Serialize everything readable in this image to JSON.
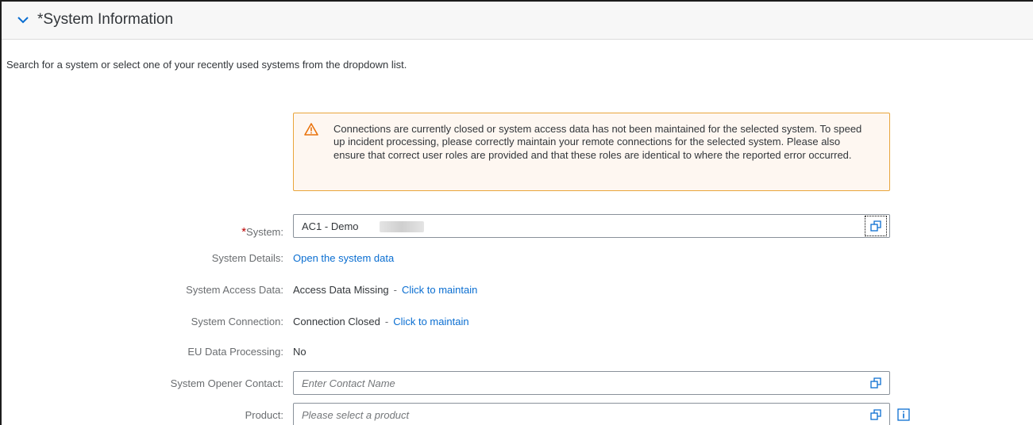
{
  "section": {
    "title": "*System Information",
    "collapse_icon": "chevron-down-icon"
  },
  "intro_text": "Search for a system or select one of your recently used systems from the dropdown list.",
  "warning": {
    "icon": "warning-triangle-icon",
    "message": "Connections are currently closed or system access data has not been maintained for the selected system. To speed up incident processing, please correctly maintain your remote connections for the selected system. Please also ensure that correct user roles are provided and that these roles are identical to where the reported error occurred."
  },
  "form": {
    "system": {
      "required_mark": "*",
      "label": "System:",
      "value": "AC1 - Demo"
    },
    "system_details": {
      "label": "System Details:",
      "link": "Open the system data"
    },
    "system_access_data": {
      "label": "System Access Data:",
      "status": "Access Data Missing",
      "separator": "-",
      "link": "Click to maintain"
    },
    "system_connection": {
      "label": "System Connection:",
      "status": "Connection Closed",
      "separator": "-",
      "link": "Click to maintain"
    },
    "eu_data_processing": {
      "label": "EU Data Processing:",
      "value": "No"
    },
    "system_opener_contact": {
      "label": "System Opener Contact:",
      "placeholder": "Enter Contact Name"
    },
    "product": {
      "label": "Product:",
      "placeholder": "Please select a product"
    }
  },
  "icons": {
    "value_help": "value-help-icon",
    "info": "info-icon"
  },
  "colors": {
    "link": "#0a6ed1",
    "required": "#bb0000",
    "warning_border": "#e9a53b",
    "warning_bg": "#fef7f1"
  }
}
